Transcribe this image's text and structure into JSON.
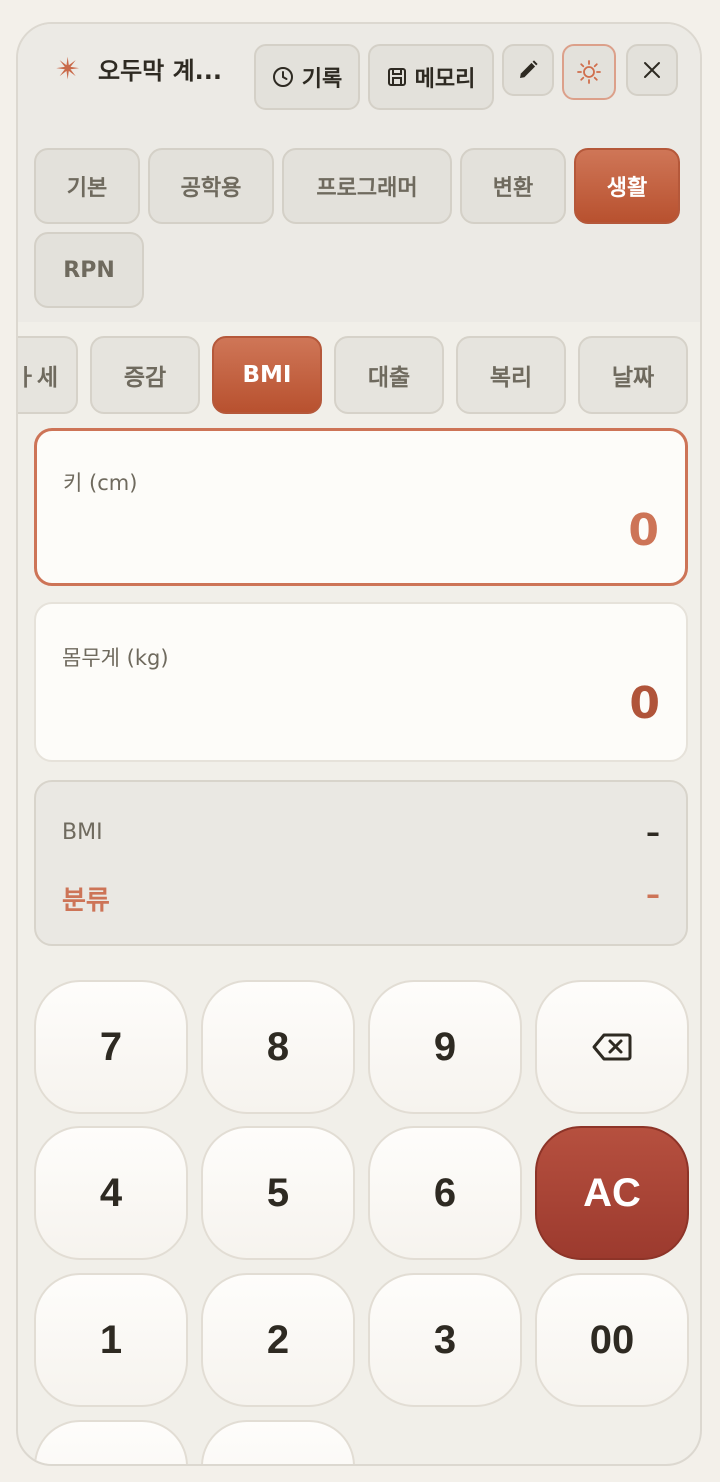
{
  "header": {
    "title": "오두막 계...",
    "history_label": "기록",
    "memory_label": "메모리"
  },
  "mode_tabs": [
    "기본",
    "공학용",
    "프로그래머",
    "변환",
    "생활",
    "RPN"
  ],
  "active_mode": "생활",
  "life_tabs": [
    "할인/세",
    "증감",
    "BMI",
    "대출",
    "복리",
    "날짜"
  ],
  "life_tabs_visible_first": "ㅏ세",
  "active_life_tab": "BMI",
  "height_field": {
    "label": "키 (cm)",
    "value": "0"
  },
  "weight_field": {
    "label": "몸무게 (kg)",
    "value": "0"
  },
  "result": {
    "bmi_label": "BMI",
    "bmi_value": "–",
    "category_label": "분류",
    "category_value": "–"
  },
  "keypad": [
    "7",
    "8",
    "9",
    "backspace",
    "4",
    "5",
    "6",
    "AC",
    "1",
    "2",
    "3",
    "00"
  ],
  "colors": {
    "accent": "#c96a4a",
    "ac_button": "#a8443a",
    "background": "#f1efe9"
  }
}
